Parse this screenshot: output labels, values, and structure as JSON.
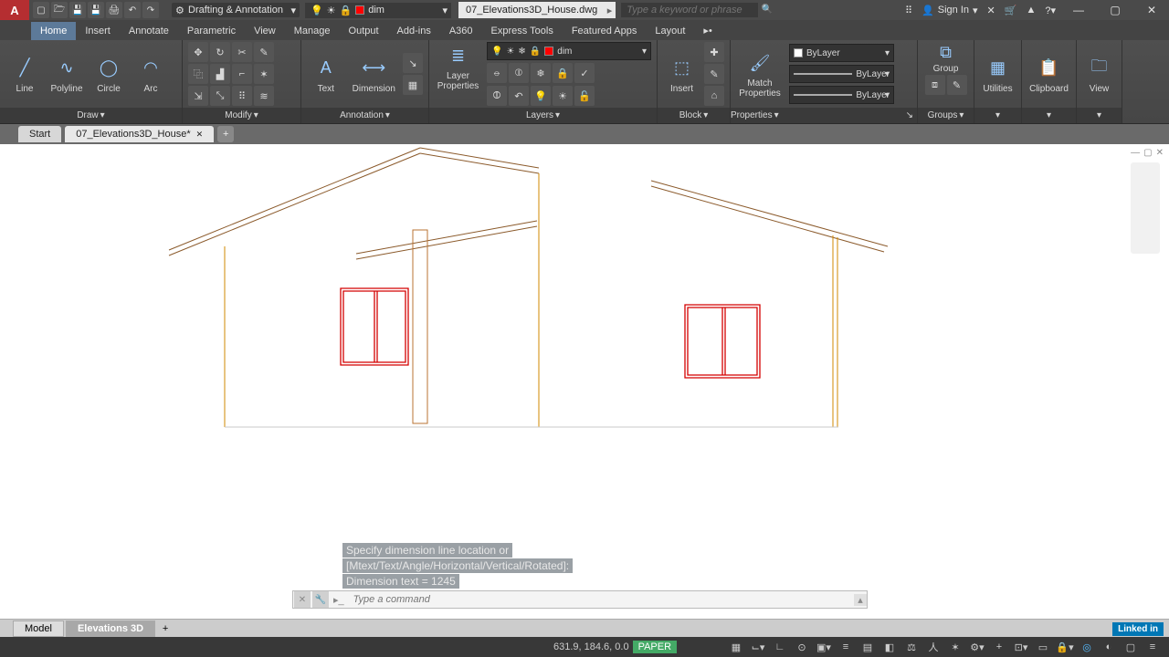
{
  "app": {
    "logo": "A"
  },
  "titlebar": {
    "workspace": "Drafting & Annotation",
    "layer_current": "dim",
    "filename": "07_Elevations3D_House.dwg",
    "search_placeholder": "Type a keyword or phrase",
    "signin": "Sign In"
  },
  "menutabs": [
    "Home",
    "Insert",
    "Annotate",
    "Parametric",
    "View",
    "Manage",
    "Output",
    "Add-ins",
    "A360",
    "Express Tools",
    "Featured Apps",
    "Layout"
  ],
  "menutab_active": 0,
  "ribbon": {
    "draw": {
      "title": "Draw",
      "line": "Line",
      "polyline": "Polyline",
      "circle": "Circle",
      "arc": "Arc"
    },
    "modify": {
      "title": "Modify"
    },
    "annotation": {
      "title": "Annotation",
      "text": "Text",
      "dimension": "Dimension"
    },
    "layers": {
      "title": "Layers",
      "layer_props": "Layer\nProperties",
      "current": "dim"
    },
    "block": {
      "title": "Block",
      "insert": "Insert"
    },
    "properties": {
      "title": "Properties",
      "match": "Match\nProperties",
      "color": "ByLayer",
      "lw": "ByLayer",
      "lt": "ByLayer"
    },
    "groups": {
      "title": "Groups",
      "group": "Group"
    },
    "utilities": {
      "title": "Utilities"
    },
    "clipboard": {
      "title": "Clipboard"
    },
    "view": {
      "title": "View"
    }
  },
  "file_tabs": {
    "start": "Start",
    "active": "07_Elevations3D_House*"
  },
  "command": {
    "history": [
      "Specify dimension line location or",
      "[Mtext/Text/Angle/Horizontal/Vertical/Rotated]:",
      "Dimension text = 1245"
    ],
    "prompt_placeholder": "Type a command"
  },
  "layout_tabs": {
    "model": "Model",
    "active": "Elevations 3D"
  },
  "statusbar": {
    "coords": "631.9, 184.6, 0.0",
    "space": "PAPER"
  },
  "branding": {
    "linkedin": "Linked in"
  }
}
